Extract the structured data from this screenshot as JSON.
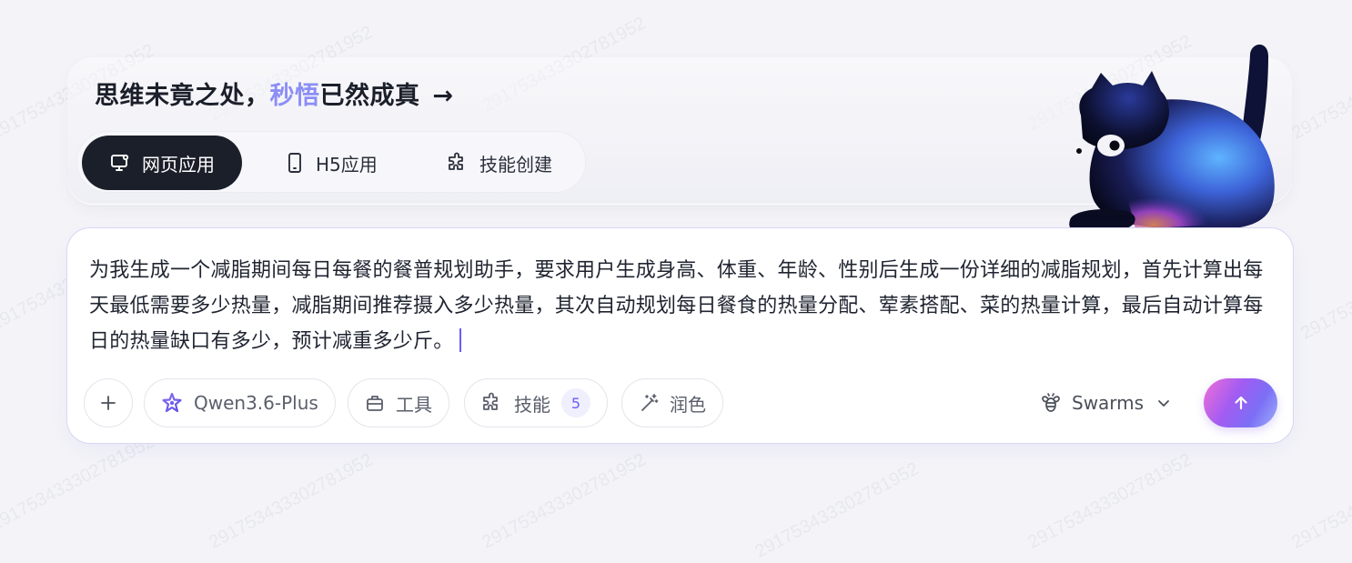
{
  "headline": {
    "prefix": "思维未竟之处，",
    "accent": "秒悟",
    "suffix": "已然成真",
    "arrow": "→"
  },
  "tabs": [
    {
      "label": "网页应用",
      "icon": "monitor-icon",
      "active": true
    },
    {
      "label": "H5应用",
      "icon": "phone-icon",
      "active": false
    },
    {
      "label": "技能创建",
      "icon": "puzzle-icon",
      "active": false
    }
  ],
  "prompt": {
    "text": "为我生成一个减脂期间每日每餐的餐普规划助手，要求用户生成身高、体重、年龄、性别后生成一份详细的减脂规划，首先计算出每天最低需要多少热量，减脂期间推荐摄入多少热量，其次自动规划每日餐食的热量分配、荤素搭配、菜的热量计算，最后自动计算每日的热量缺口有多少，预计减重多少斤。"
  },
  "toolbar": {
    "add_icon": "plus-icon",
    "model": {
      "label": "Qwen3.6-Plus",
      "icon": "sparkle-star-icon"
    },
    "tools": {
      "label": "工具",
      "icon": "toolbox-icon"
    },
    "skills": {
      "label": "技能",
      "icon": "puzzle-icon",
      "count": "5"
    },
    "polish": {
      "label": "润色",
      "icon": "magic-wand-icon"
    },
    "swarms": {
      "label": "Swarms",
      "icon": "bee-icon"
    },
    "send_icon": "arrow-up-icon"
  },
  "colors": {
    "accent": "#8b8ef5",
    "active_tab_bg": "#1b1f29",
    "badge_text": "#6b5cf6"
  }
}
